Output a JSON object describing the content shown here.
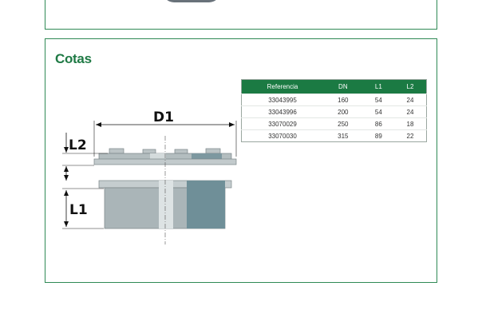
{
  "section": {
    "title": "Cotas"
  },
  "table": {
    "headers": [
      "Referencia",
      "DN",
      "L1",
      "L2"
    ],
    "rows": [
      [
        "33043995",
        "160",
        "54",
        "24"
      ],
      [
        "33043996",
        "200",
        "54",
        "24"
      ],
      [
        "33070029",
        "250",
        "86",
        "18"
      ],
      [
        "33070030",
        "315",
        "89",
        "22"
      ]
    ]
  },
  "drawing": {
    "dimension_labels": {
      "d1": "D1",
      "l2": "L2",
      "l1": "L1"
    },
    "colors": {
      "frame": "#2f8a55",
      "header": "#1b7a43",
      "body": "#aab5b8",
      "dark_band": "#6f8f98"
    }
  }
}
